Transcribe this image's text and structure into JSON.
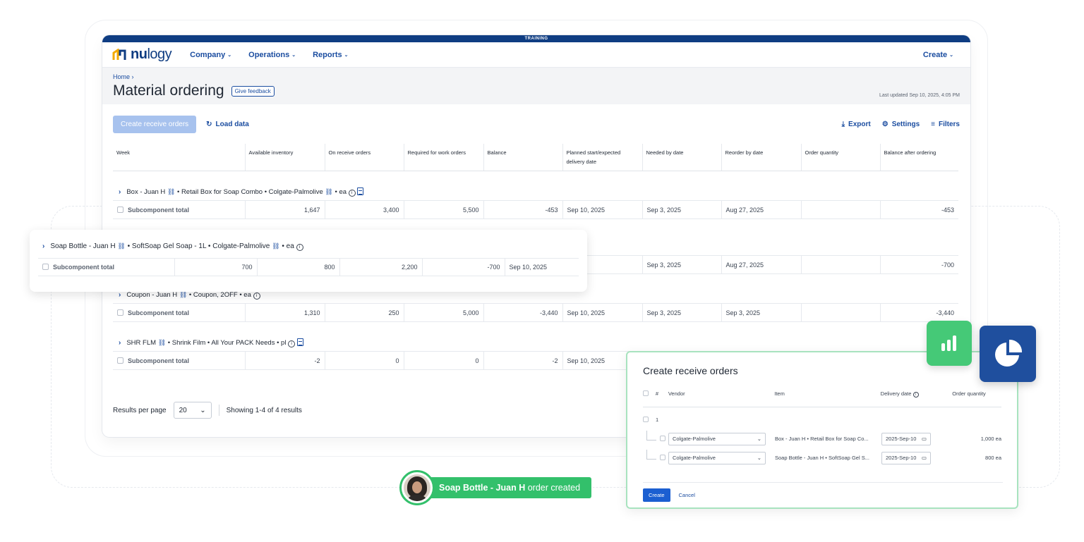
{
  "app": {
    "training_label": "TRAINING",
    "brand_bold": "nu",
    "brand_light": "logy",
    "nav": [
      {
        "label": "Company"
      },
      {
        "label": "Operations"
      },
      {
        "label": "Reports"
      }
    ],
    "create_label": "Create",
    "breadcrumb": "Home",
    "page_title": "Material ordering",
    "feedback_label": "Give feedback",
    "last_updated": "Last updated Sep 10, 2025, 4:05 PM"
  },
  "toolbar": {
    "create_receive_orders": "Create receive orders",
    "load_data": "Load data",
    "export": "Export",
    "settings": "Settings",
    "filters": "Filters"
  },
  "table": {
    "columns": [
      "Week",
      "Available inventory",
      "On receive orders",
      "Required for work orders",
      "Balance",
      "Planned start/expected delivery date",
      "Needed by date",
      "Reorder by date",
      "Order quantity",
      "Balance after ordering"
    ],
    "groups": [
      {
        "name": "Box - Juan H",
        "desc": "• Retail Box for Soap Combo • Colgate-Palmolive",
        "unit": "• ea",
        "row": {
          "label": "Subcomponent total",
          "available": "1,647",
          "on_receive": "3,400",
          "required": "5,500",
          "balance": "-453",
          "planned": "Sep 10, 2025",
          "needed": "Sep 3, 2025",
          "reorder": "Aug 27, 2025",
          "order_qty": "",
          "after": "-453"
        }
      },
      {
        "name": "Soap Bottle - Juan H",
        "desc": "• SoftSoap Gel Soap - 1L • Colgate-Palmolive",
        "unit": "• ea",
        "row": {
          "label": "Subcomponent total",
          "available": "700",
          "on_receive": "800",
          "required": "2,200",
          "balance": "-700",
          "planned": "Sep 10, 2025",
          "planned_partial": "2025",
          "needed": "Sep 3, 2025",
          "reorder": "Aug 27, 2025",
          "order_qty": "",
          "after": "-700"
        }
      },
      {
        "name": "Coupon - Juan H",
        "desc": "• Coupon, 2OFF",
        "unit": "• ea",
        "row": {
          "label": "Subcomponent total",
          "available": "1,310",
          "on_receive": "250",
          "required": "5,000",
          "balance": "-3,440",
          "planned": "Sep 10, 2025",
          "needed": "Sep 3, 2025",
          "reorder": "Sep 3, 2025",
          "order_qty": "",
          "after": "-3,440"
        }
      },
      {
        "name": "SHR FLM",
        "desc": "• Shrink Film • All Your PACK Needs",
        "unit": "• pl",
        "row": {
          "label": "Subcomponent total",
          "available": "-2",
          "on_receive": "0",
          "required": "0",
          "balance": "-2",
          "planned": "Sep 10, 2025"
        }
      }
    ]
  },
  "pager": {
    "label": "Results per page",
    "value": "20",
    "showing": "Showing 1-4 of 4 results"
  },
  "toast": {
    "name": "Soap Bottle - Juan H",
    "message": "order created"
  },
  "modal": {
    "title": "Create receive orders",
    "columns": {
      "num": "#",
      "vendor": "Vendor",
      "item": "Item",
      "delivery": "Delivery date",
      "qty": "Order quantity"
    },
    "group_num": "1",
    "rows": [
      {
        "vendor": "Colgate-Palmolive",
        "item": "Box - Juan H • Retail Box for Soap Co...",
        "date": "2025-Sep-10",
        "qty": "1,000 ea"
      },
      {
        "vendor": "Colgate-Palmolive",
        "item": "Soap Bottle - Juan H • SoftSoap Gel S...",
        "date": "2025-Sep-10",
        "qty": "800 ea"
      }
    ],
    "create": "Create",
    "cancel": "Cancel"
  },
  "colors": {
    "brand": "#0f3d82",
    "link": "#1b4da0",
    "negative": "#d6282f",
    "success": "#33c06b"
  }
}
